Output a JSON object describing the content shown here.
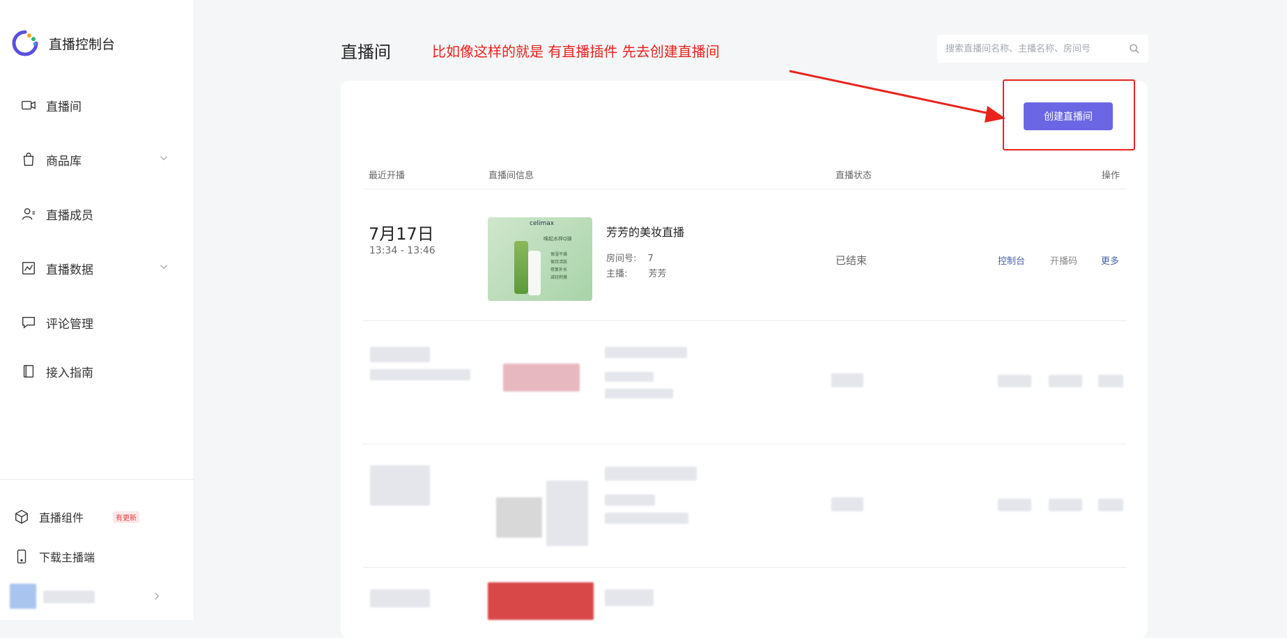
{
  "sidebar": {
    "title": "直播控制台",
    "items": [
      {
        "label": "直播间",
        "icon": "video-camera-icon"
      },
      {
        "label": "商品库",
        "icon": "shopping-bag-icon",
        "expandable": true
      },
      {
        "label": "直播成员",
        "icon": "user-icon"
      },
      {
        "label": "直播数据",
        "icon": "chart-icon",
        "expandable": true
      },
      {
        "label": "评论管理",
        "icon": "comment-icon"
      },
      {
        "label": "接入指南",
        "icon": "book-icon"
      }
    ],
    "bottom": {
      "component_label": "直播组件",
      "component_badge": "有更新",
      "download_label": "下载主播端"
    }
  },
  "header": {
    "title": "直播间",
    "annotation": "比如像这样的就是 有直播插件  先去创建直播间",
    "search_placeholder": "搜索直播间名称、主播名称、房间号"
  },
  "toolbar": {
    "create_label": "创建直播间"
  },
  "table": {
    "columns": [
      "最近开播",
      "直播间信息",
      "直播状态",
      "操作"
    ],
    "rows": [
      {
        "date": "7月17日",
        "time": "13:34 - 13:46",
        "name": "芳芳的美妆直播",
        "room_label": "房间号:",
        "room_value": "7",
        "host_label": "主播:",
        "host_value": "芳芳",
        "status": "已结束",
        "actions": [
          "控制台",
          "开播码",
          "更多"
        ]
      }
    ]
  },
  "thumbnail": {
    "brand": "celimax",
    "slogan": "唤起水样Q弹",
    "features": [
      "保湿干燥",
      "保持活肤",
      "修复补水",
      "减轻刺激"
    ]
  },
  "colors": {
    "accent": "#6b67e4",
    "link": "#4a5fa8",
    "annotation": "#e8231c"
  }
}
